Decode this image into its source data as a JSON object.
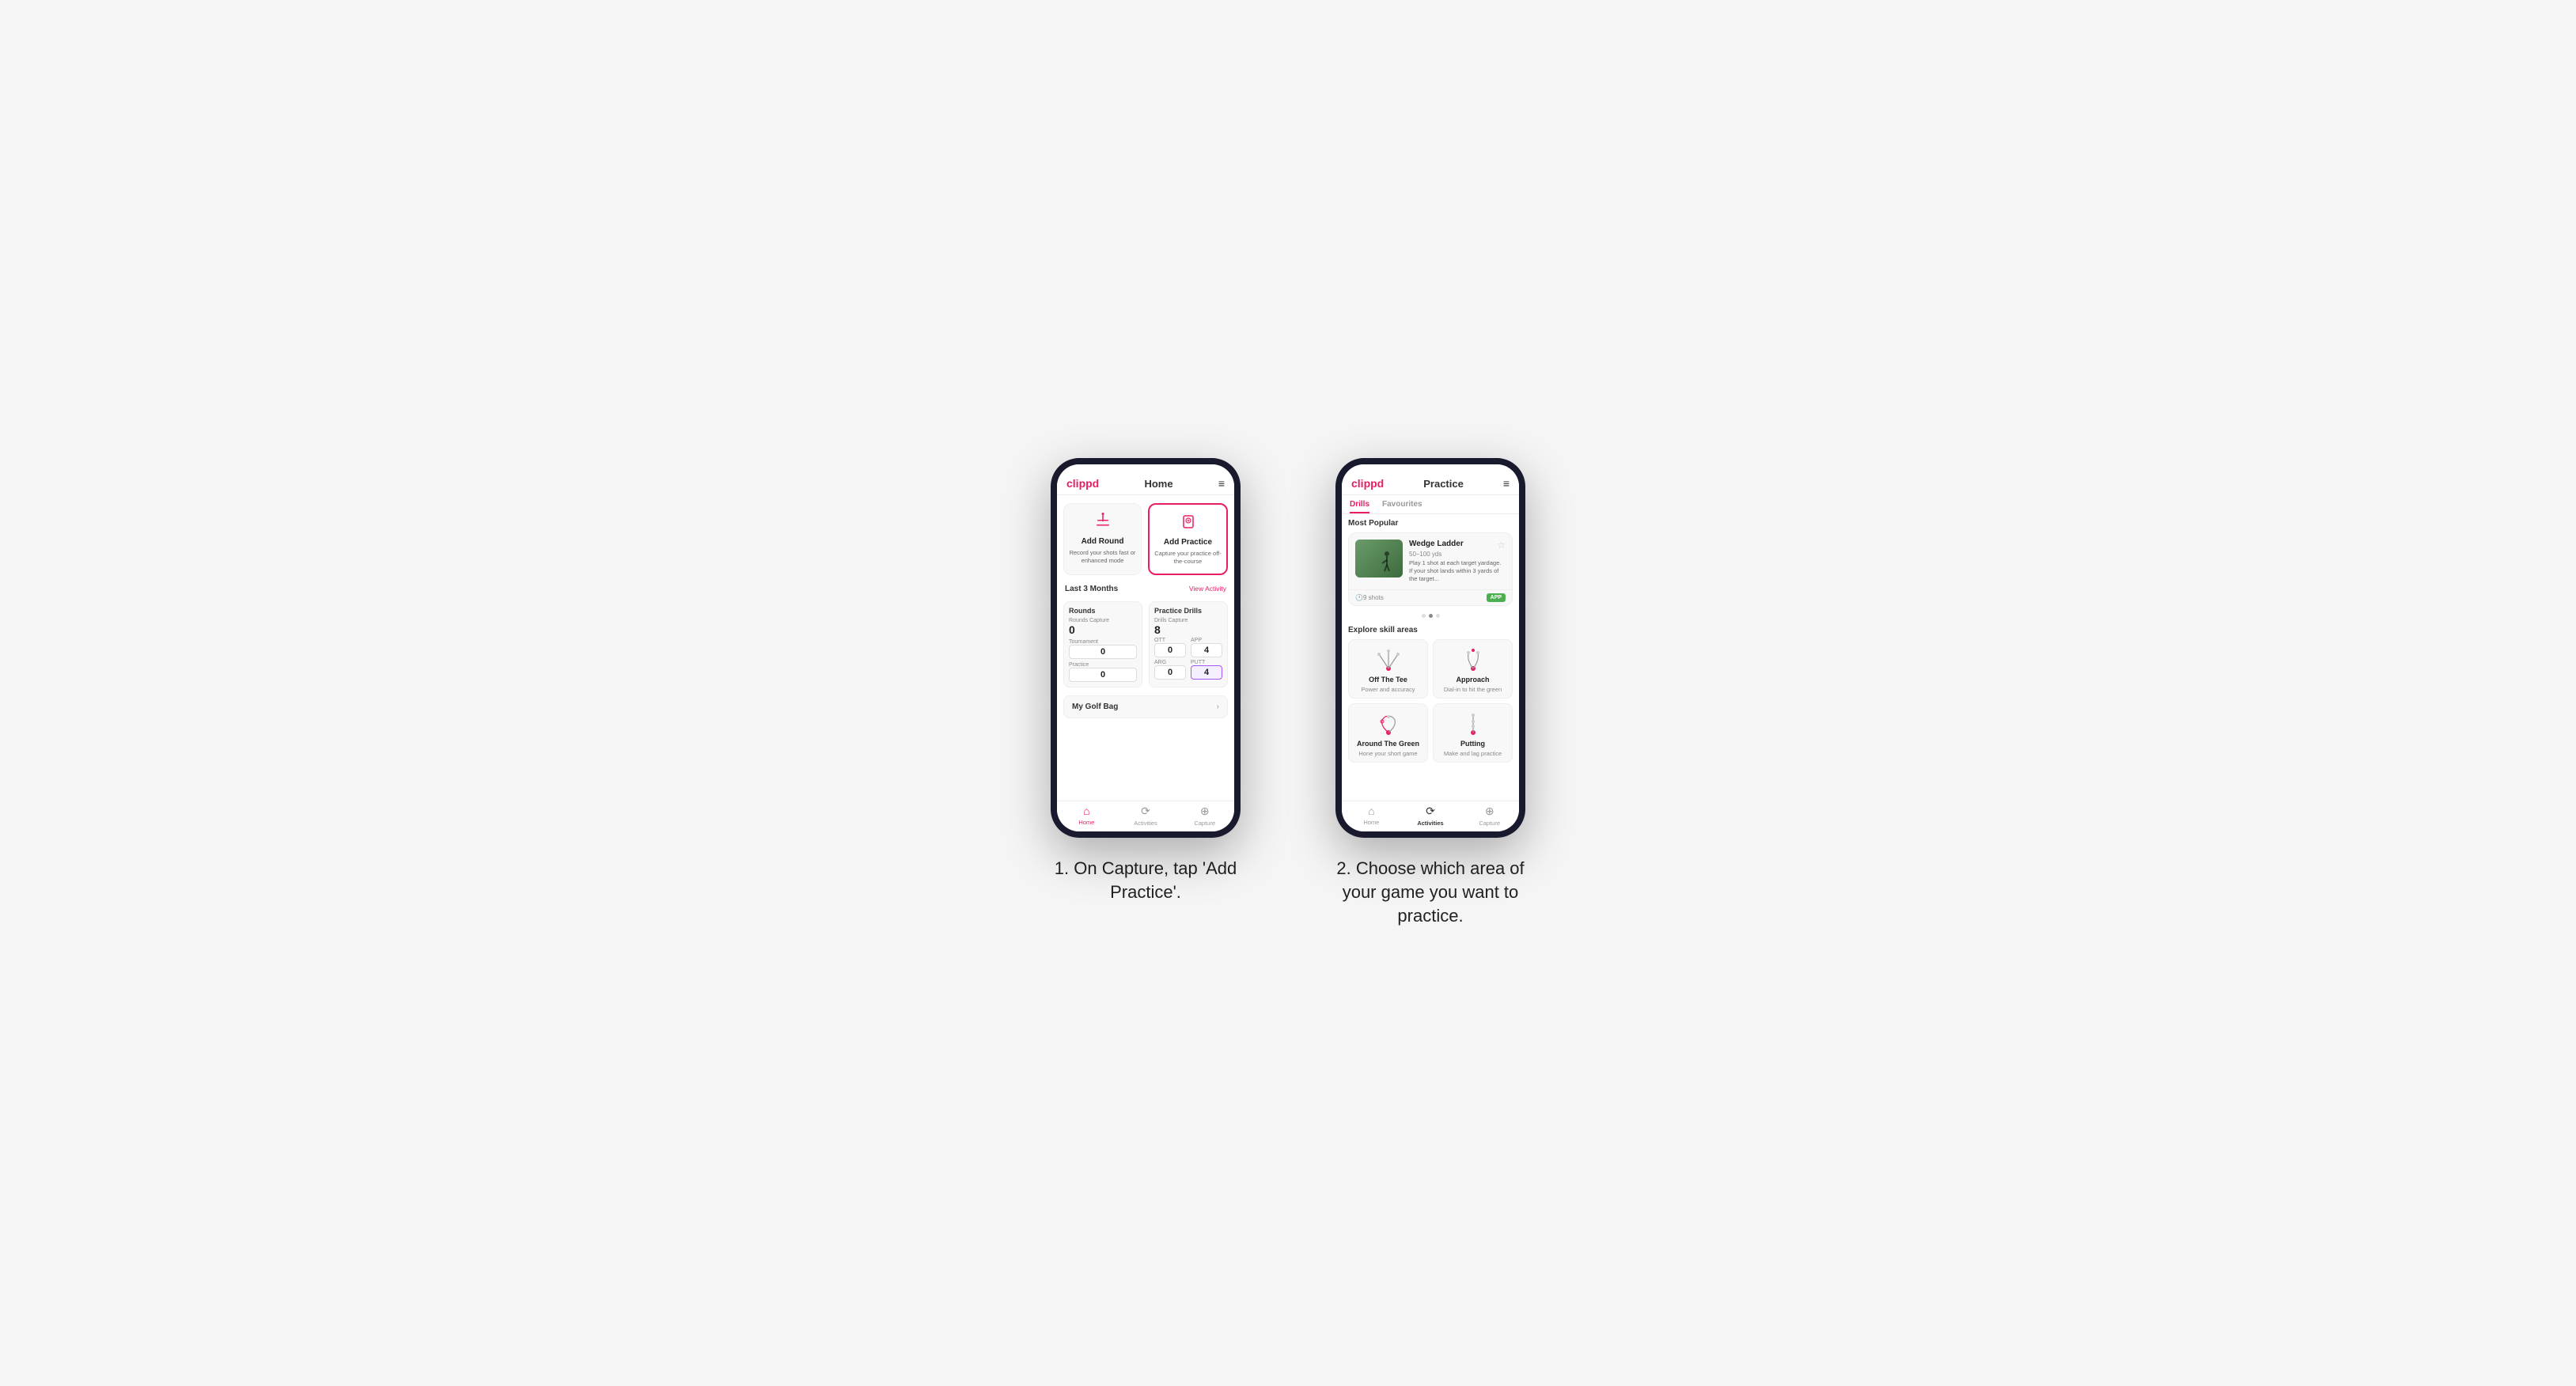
{
  "page": {
    "background": "#f5f5f5"
  },
  "phone1": {
    "header": {
      "logo": "clippd",
      "title": "Home",
      "menu_icon": "≡"
    },
    "action_cards": [
      {
        "id": "add-round",
        "title": "Add Round",
        "subtitle": "Record your shots fast or enhanced mode",
        "icon": "⛳"
      },
      {
        "id": "add-practice",
        "title": "Add Practice",
        "subtitle": "Capture your practice off-the-course",
        "icon": "📋"
      }
    ],
    "last3months": {
      "label": "Last 3 Months",
      "link": "View Activity"
    },
    "rounds_panel": {
      "title": "Rounds",
      "rounds_capture_label": "Rounds Capture",
      "rounds_capture_value": "0",
      "tournament_label": "Tournament",
      "tournament_value": "0",
      "practice_label": "Practice",
      "practice_value": "0"
    },
    "drills_panel": {
      "title": "Practice Drills",
      "drills_capture_label": "Drills Capture",
      "drills_capture_value": "8",
      "ott_label": "OTT",
      "ott_value": "0",
      "app_label": "APP",
      "app_value": "4",
      "arg_label": "ARG",
      "arg_value": "0",
      "putt_label": "PUTT",
      "putt_value": "4"
    },
    "my_golf_bag": {
      "label": "My Golf Bag"
    },
    "bottom_nav": [
      {
        "id": "home",
        "label": "Home",
        "icon": "⌂",
        "active": true
      },
      {
        "id": "activities",
        "label": "Activities",
        "icon": "♻",
        "active": false
      },
      {
        "id": "capture",
        "label": "Capture",
        "icon": "⊕",
        "active": false
      }
    ]
  },
  "phone2": {
    "header": {
      "logo": "clippd",
      "title": "Practice",
      "menu_icon": "≡"
    },
    "tabs": [
      {
        "label": "Drills",
        "active": true
      },
      {
        "label": "Favourites",
        "active": false
      }
    ],
    "most_popular_label": "Most Popular",
    "featured": {
      "title": "Wedge Ladder",
      "subtitle": "50–100 yds",
      "description": "Play 1 shot at each target yardage. If your shot lands within 3 yards of the target...",
      "shots": "9 shots",
      "badge": "APP"
    },
    "carousel_dots": [
      {
        "active": false
      },
      {
        "active": true
      },
      {
        "active": false
      }
    ],
    "explore_label": "Explore skill areas",
    "skill_areas": [
      {
        "id": "off-the-tee",
        "name": "Off The Tee",
        "desc": "Power and accuracy",
        "diagram": "ott"
      },
      {
        "id": "approach",
        "name": "Approach",
        "desc": "Dial-in to hit the green",
        "diagram": "approach"
      },
      {
        "id": "around-the-green",
        "name": "Around The Green",
        "desc": "Hone your short game",
        "diagram": "atg"
      },
      {
        "id": "putting",
        "name": "Putting",
        "desc": "Make and lag practice",
        "diagram": "putting"
      }
    ],
    "bottom_nav": [
      {
        "id": "home",
        "label": "Home",
        "icon": "⌂",
        "active": false
      },
      {
        "id": "activities",
        "label": "Activities",
        "icon": "♻",
        "active": true
      },
      {
        "id": "capture",
        "label": "Capture",
        "icon": "⊕",
        "active": false
      }
    ]
  },
  "captions": [
    {
      "number": "1.",
      "text": "On Capture, tap 'Add Practice'."
    },
    {
      "number": "2.",
      "text": "Choose which area of your game you want to practice."
    }
  ]
}
